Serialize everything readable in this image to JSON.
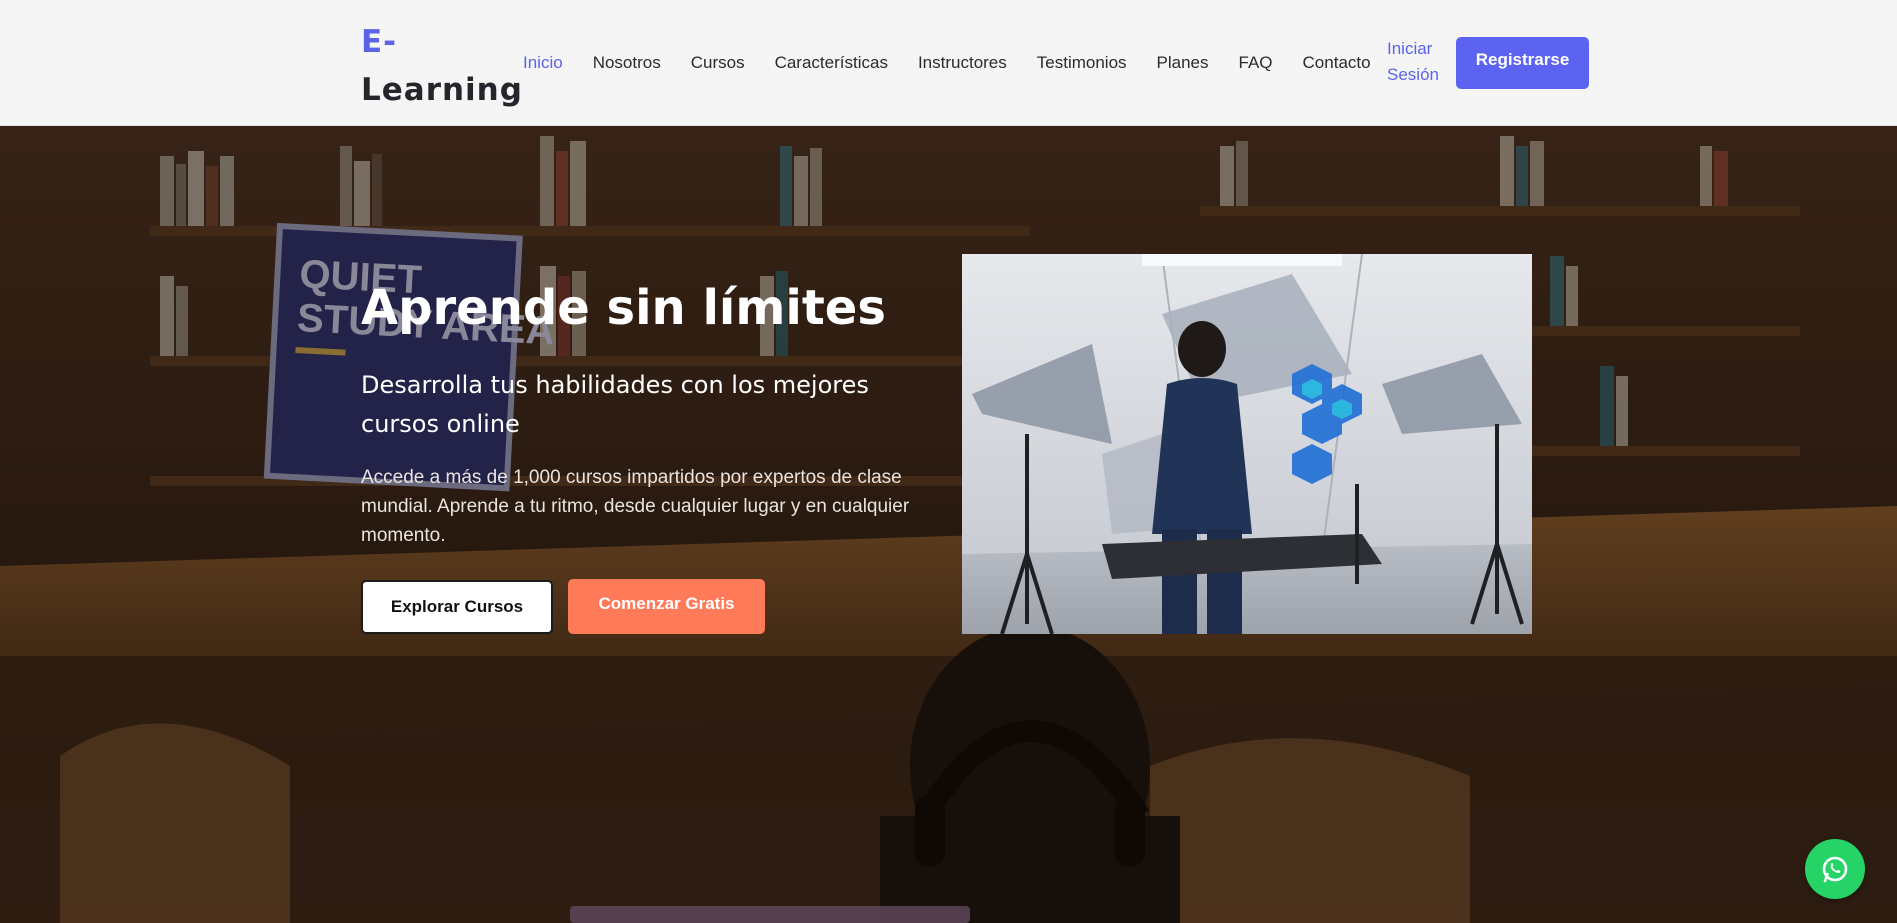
{
  "brand": {
    "accent": "E-",
    "rest": "Learning",
    "accent_color": "#5b63e8"
  },
  "nav": {
    "items": [
      {
        "label": "Inicio",
        "active": true
      },
      {
        "label": "Nosotros",
        "active": false
      },
      {
        "label": "Cursos",
        "active": false
      },
      {
        "label": "Características",
        "active": false
      },
      {
        "label": "Instructores",
        "active": false
      },
      {
        "label": "Testimonios",
        "active": false
      },
      {
        "label": "Planes",
        "active": false
      },
      {
        "label": "FAQ",
        "active": false
      },
      {
        "label": "Contacto",
        "active": false
      }
    ],
    "login_label": "Iniciar Sesión",
    "register_label": "Registrarse"
  },
  "hero": {
    "title": "Aprende sin límites",
    "subtitle": "Desarrolla tus habilidades con los mejores cursos online",
    "description": "Accede a más de 1,000 cursos impartidos por expertos de clase mundial. Aprende a tu ritmo, desde cualquier lugar y en cualquier momento.",
    "explore_label": "Explorar Cursos",
    "start_label": "Comenzar Gratis",
    "background_sign": "QUIET STUDY AREA"
  },
  "floating": {
    "whatsapp_icon": "whatsapp-icon"
  },
  "colors": {
    "primary": "#5b63f0",
    "cta": "#ff7a59",
    "whatsapp": "#25d366"
  }
}
